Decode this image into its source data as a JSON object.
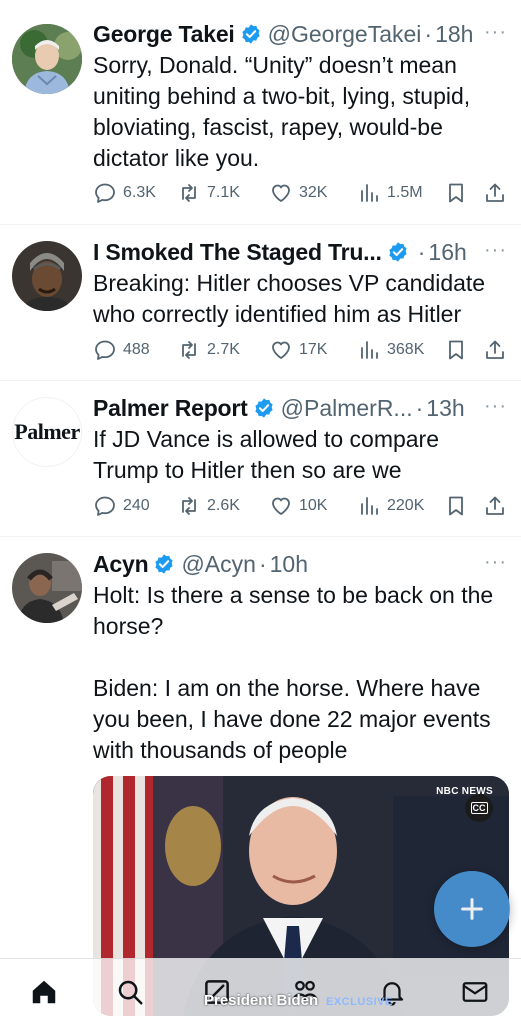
{
  "colors": {
    "verified": "#1d9bf0",
    "text": "#0f1419",
    "secondary": "#536471",
    "fab": "#4a94d6"
  },
  "tweets": [
    {
      "name": "George Takei",
      "handle": "@GeorgeTakei",
      "time": "18h",
      "text": "Sorry, Donald. “Unity” doesn’t mean uniting behind a two-bit, lying, stupid, bloviating, fascist, rapey, would-be dictator like you.",
      "replies": "6.3K",
      "reposts": "7.1K",
      "likes": "32K",
      "views": "1.5M"
    },
    {
      "name": "I Smoked The Staged Tru...",
      "handle": "",
      "time": "16h",
      "text": "Breaking: Hitler chooses VP candidate who correctly identified him as Hitler",
      "replies": "488",
      "reposts": "2.7K",
      "likes": "17K",
      "views": "368K"
    },
    {
      "name": "Palmer Report",
      "handle": "@PalmerR...",
      "time": "13h",
      "avatar_text": "Palmer",
      "text": "If JD Vance is allowed to compare Trump to Hitler then so are we",
      "replies": "240",
      "reposts": "2.6K",
      "likes": "10K",
      "views": "220K"
    },
    {
      "name": "Acyn",
      "handle": "@Acyn",
      "time": "10h",
      "text": "Holt: Is there a sense to be back on the horse?\n\nBiden: I am on the horse. Where have you been, I have done 22 major events with thousands of people",
      "media": {
        "network": "NBC NEWS",
        "cc": "CC",
        "caption": "President Biden",
        "badge": "EXCLUSIVE"
      }
    }
  ],
  "more_label": "···",
  "separator": "·",
  "nav": [
    "home-icon",
    "search-icon",
    "compose-icon",
    "communities-icon",
    "notifications-icon",
    "messages-icon"
  ]
}
